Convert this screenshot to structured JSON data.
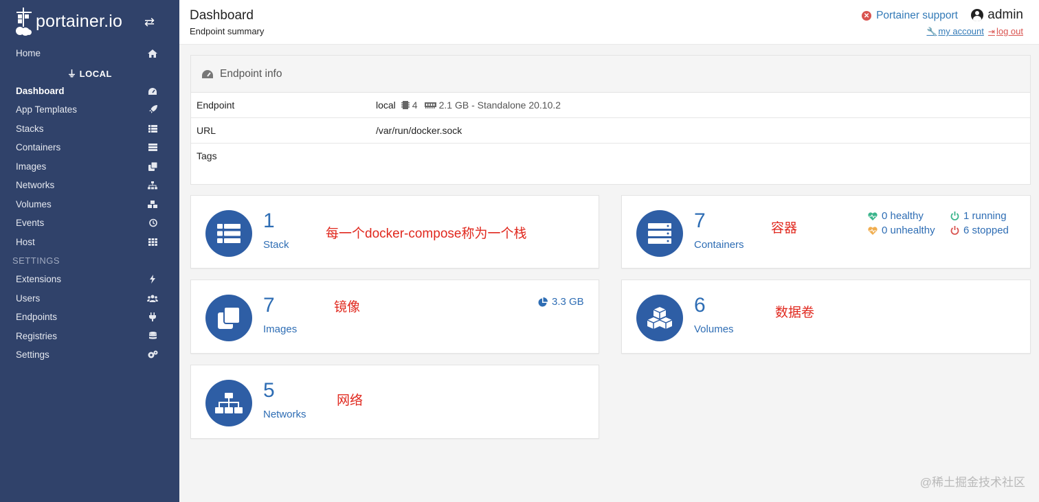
{
  "sidebar": {
    "logo_text": "portainer.io",
    "home": "Home",
    "endpoint_name": "LOCAL",
    "items": [
      {
        "label": "Dashboard"
      },
      {
        "label": "App Templates"
      },
      {
        "label": "Stacks"
      },
      {
        "label": "Containers"
      },
      {
        "label": "Images"
      },
      {
        "label": "Networks"
      },
      {
        "label": "Volumes"
      },
      {
        "label": "Events"
      },
      {
        "label": "Host"
      }
    ],
    "settings_title": "SETTINGS",
    "settings_items": [
      {
        "label": "Extensions"
      },
      {
        "label": "Users"
      },
      {
        "label": "Endpoints"
      },
      {
        "label": "Registries"
      },
      {
        "label": "Settings"
      }
    ]
  },
  "header": {
    "title": "Dashboard",
    "subtitle": "Endpoint summary",
    "support": "Portainer support",
    "user": "admin",
    "my_account": "my account",
    "log_out": "log out"
  },
  "endpoint_info": {
    "title": "Endpoint info",
    "rows": [
      {
        "key": "Endpoint",
        "value": "local",
        "cpu": "4",
        "mem": "2.1 GB - Standalone 20.10.2"
      },
      {
        "key": "URL",
        "value": "/var/run/docker.sock"
      },
      {
        "key": "Tags",
        "value": ""
      }
    ]
  },
  "widgets": {
    "stack": {
      "count": "1",
      "label": "Stack",
      "note": "每一个docker-compose称为一个栈"
    },
    "containers": {
      "count": "7",
      "label": "Containers",
      "note": "容器",
      "healthy": "0 healthy",
      "unhealthy": "0 unhealthy",
      "running": "1 running",
      "stopped": "6 stopped"
    },
    "images": {
      "count": "7",
      "label": "Images",
      "note": "镜像",
      "size": "3.3 GB"
    },
    "volumes": {
      "count": "6",
      "label": "Volumes",
      "note": "数据卷"
    },
    "networks": {
      "count": "5",
      "label": "Networks",
      "note": "网络"
    }
  },
  "watermark": "@稀土掘金技术社区",
  "colors": {
    "sidebar": "#30426a",
    "accent": "#2e6db4",
    "icon_circle": "#2e5ea5",
    "annotation": "#e0281e"
  }
}
